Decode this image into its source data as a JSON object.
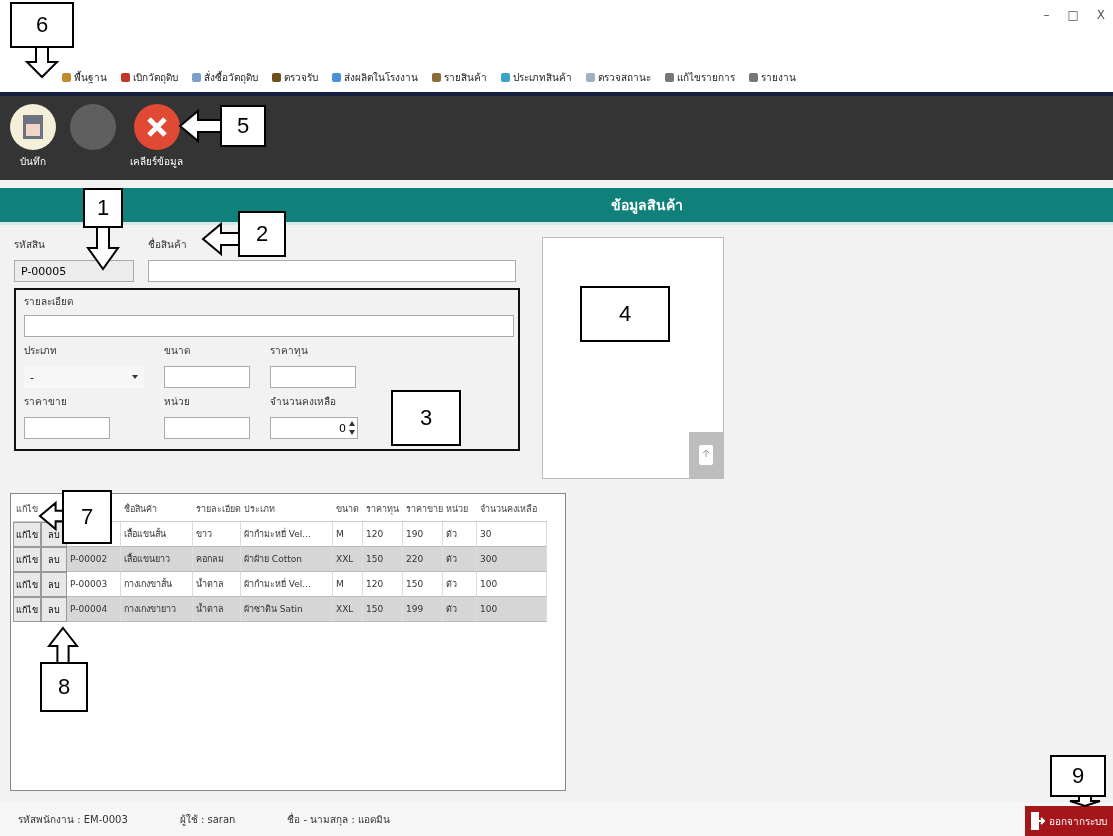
{
  "window_controls": [
    "–",
    "□",
    "X"
  ],
  "menu": [
    "พื้นฐาน",
    "เบิกวัตถุดิบ",
    "สั่งซื้อวัตถุดิบ",
    "ตรวจรับ",
    "ส่งผลิตในโรงงาน",
    "รายสินค้า",
    "ประเภทสินค้า",
    "ตรวจสถานะ",
    "แก้ไขรายการ",
    "รายงาน"
  ],
  "toolbar": [
    {
      "label": "บันทึก",
      "kind": "save",
      "disabled": false
    },
    {
      "kind": "blank",
      "disabled": true
    },
    {
      "label": "เคลียร์ข้อมูล",
      "kind": "clear",
      "disabled": false
    }
  ],
  "header": "ข้อมูลสินค้า",
  "form": {
    "code_label": "รหัสสิน",
    "code_value": "P-00005",
    "name_label": "ชื่อสินค้า",
    "detail_label": "รายละเอียด",
    "type_label": "ประเภท",
    "type_value": "-",
    "size_label": "ขนาด",
    "cost_label": "ราคาทุน",
    "price_label": "ราคาขาย",
    "unit_label": "หน่วย",
    "stock_label": "จำนวนคงเหลือ",
    "stock_value": "0"
  },
  "table": {
    "columns": [
      "แก้ไข",
      "",
      "",
      "ชื่อสินค้า",
      "รายละเอียด",
      "ประเภท",
      "ขนาด",
      "ราคาทุน",
      "ราคาขาย",
      "หน่วย",
      "จำนวนคงเหลือ"
    ],
    "rows": [
      {
        "cells": [
          "แก้ไข",
          "ลบ",
          "",
          "เสื้อแขนสั้น",
          "ขาว",
          "ผ้ากำมะหยี่ Vel...",
          "M",
          "120",
          "190",
          "ตัว",
          "30"
        ]
      },
      {
        "cells": [
          "แก้ไข",
          "ลบ",
          "P-00002",
          "เสื้อแขนยาว",
          "คอกลม",
          "ผ้าฝ้าย Cotton",
          "XXL",
          "150",
          "220",
          "ตัว",
          "300"
        ]
      },
      {
        "cells": [
          "แก้ไข",
          "ลบ",
          "P-00003",
          "กางเกงขาสั้น",
          "น้ำตาล",
          "ผ้ากำมะหยี่ Vel...",
          "M",
          "120",
          "150",
          "ตัว",
          "100"
        ]
      },
      {
        "cells": [
          "แก้ไข",
          "ลบ",
          "P-00004",
          "กางเกงขายาว",
          "น้ำตาล",
          "ผ้าซาติน Satin",
          "XXL",
          "150",
          "199",
          "ตัว",
          "100"
        ]
      }
    ]
  },
  "status_bar": [
    {
      "label": "รหัสพนักงาน :",
      "value": "EM-0003"
    },
    {
      "label": "ผู้ใช้ :",
      "value": "saran"
    },
    {
      "label": "ชื่อ - นามสกุล :",
      "value": "แอดมิน"
    }
  ],
  "logout": "ออกจากระบบ",
  "callouts": [
    {
      "number": "6"
    },
    {
      "number": "5"
    },
    {
      "number": "1"
    },
    {
      "number": "2"
    },
    {
      "number": "3"
    },
    {
      "number": "4"
    },
    {
      "number": "7"
    },
    {
      "number": "8"
    },
    {
      "number": "9"
    }
  ]
}
